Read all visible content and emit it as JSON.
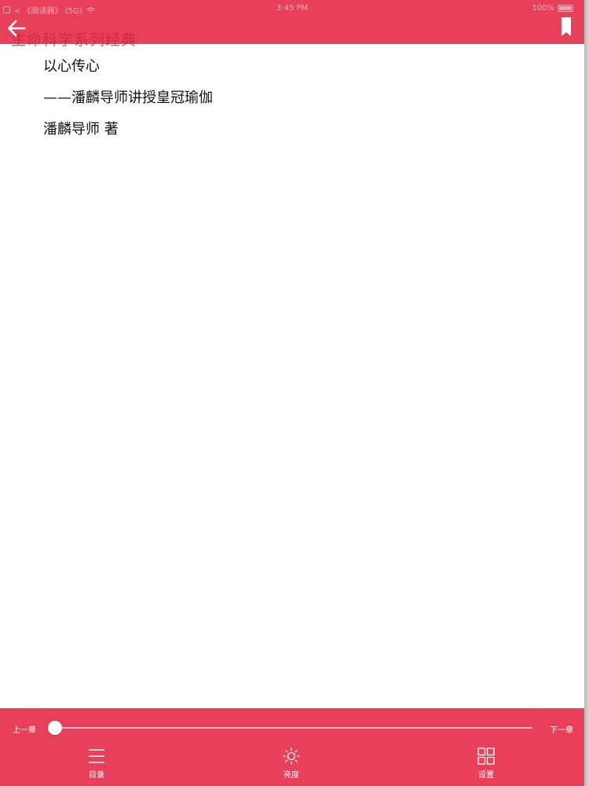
{
  "status_bar": {
    "carrier": "< 《阅读器》 (5G)",
    "time": "3:45 PM",
    "battery": "100%"
  },
  "header": {
    "title": "生命科学系列经典",
    "back_icon": "arrow-left-icon",
    "bookmark_icon": "bookmark-icon"
  },
  "content": {
    "lines": [
      "以心传心",
      "——潘麟导师讲授皇冠瑜伽",
      "潘麟导师 著"
    ]
  },
  "footer": {
    "prev_chapter": "上一章",
    "next_chapter": "下一章",
    "progress": 0,
    "tools": [
      {
        "label": "目录",
        "icon": "list-icon"
      },
      {
        "label": "亮度",
        "icon": "brightness-icon"
      },
      {
        "label": "设置",
        "icon": "grid-settings-icon"
      }
    ]
  },
  "colors": {
    "accent": "#e8405b",
    "background": "#ffffff",
    "text": "#111111"
  }
}
